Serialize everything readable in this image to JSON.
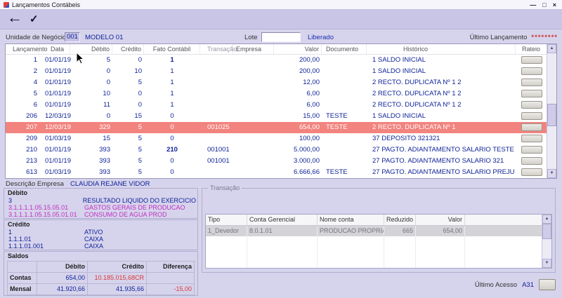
{
  "window": {
    "title": "Lançamentos Contábeis",
    "controls": {
      "minimize": "—",
      "maximize": "□",
      "close": "×"
    }
  },
  "toolbar": {
    "back_icon": "←",
    "confirm_icon": "✓"
  },
  "header_fields": {
    "unit_label": "Unidade de Negócio",
    "unit_code": "001",
    "unit_name": "MODELO 01",
    "lote_label": "Lote",
    "lote_value": "",
    "status": "Liberado",
    "last_entry_label": "Último Lançamento",
    "last_entry_value": "********"
  },
  "grid": {
    "columns": [
      "Lançamento",
      "Data",
      "Débito",
      "Crédito",
      "Fato Contábil",
      "Transação",
      "Empresa",
      "Valor",
      "Documento",
      "Histórico",
      "Rateio"
    ],
    "rows": [
      {
        "lancamento": "1",
        "data": "01/01/19",
        "debito": "5",
        "credito": "0",
        "fato_contabil": "1",
        "fato_bold": true,
        "transacao": "",
        "empresa": "",
        "valor": "200,00",
        "documento": "",
        "historico": "1 SALDO INICIAL"
      },
      {
        "lancamento": "2",
        "data": "01/01/19",
        "debito": "0",
        "credito": "10",
        "fato_contabil": "1",
        "fato_bold": false,
        "transacao": "",
        "empresa": "",
        "valor": "200,00",
        "documento": "",
        "historico": "1 SALDO INICIAL"
      },
      {
        "lancamento": "4",
        "data": "01/01/19",
        "debito": "0",
        "credito": "5",
        "fato_contabil": "1",
        "fato_bold": false,
        "transacao": "",
        "empresa": "",
        "valor": "12,00",
        "documento": "",
        "historico": "2 RECTO. DUPLICATA Nº 1 2"
      },
      {
        "lancamento": "5",
        "data": "01/01/19",
        "debito": "10",
        "credito": "0",
        "fato_contabil": "1",
        "fato_bold": false,
        "transacao": "",
        "empresa": "",
        "valor": "6,00",
        "documento": "",
        "historico": "2 RECTO. DUPLICATA Nº 1 2"
      },
      {
        "lancamento": "6",
        "data": "01/01/19",
        "debito": "11",
        "credito": "0",
        "fato_contabil": "1",
        "fato_bold": false,
        "transacao": "",
        "empresa": "",
        "valor": "6,00",
        "documento": "",
        "historico": "2 RECTO. DUPLICATA Nº 1 2"
      },
      {
        "lancamento": "206",
        "data": "12/03/19",
        "debito": "0",
        "credito": "15",
        "fato_contabil": "0",
        "fato_bold": false,
        "transacao": "",
        "empresa": "",
        "valor": "15,00",
        "documento": "TESTE",
        "historico": "1 SALDO INICIAL"
      },
      {
        "lancamento": "207",
        "data": "12/03/19",
        "debito": "329",
        "credito": "5",
        "fato_contabil": "0",
        "fato_bold": false,
        "transacao": "001025",
        "empresa": "",
        "valor": "654,00",
        "documento": "TESTE",
        "historico": "2 RECTO. DUPLICATA Nº 1",
        "selected": true
      },
      {
        "lancamento": "209",
        "data": "01/03/19",
        "debito": "15",
        "credito": "5",
        "fato_contabil": "0",
        "fato_bold": false,
        "transacao": "",
        "empresa": "",
        "valor": "100,00",
        "documento": "",
        "historico": "37 DEPOSITO 321321"
      },
      {
        "lancamento": "210",
        "data": "01/01/19",
        "debito": "393",
        "credito": "5",
        "fato_contabil": "210",
        "fato_bold": true,
        "transacao": "001001",
        "empresa": "",
        "valor": "5.000,00",
        "documento": "",
        "historico": "27 PAGTO. ADIANTAMENTO SALARIO TESTE"
      },
      {
        "lancamento": "213",
        "data": "01/01/19",
        "debito": "393",
        "credito": "5",
        "fato_contabil": "0",
        "fato_bold": false,
        "transacao": "001001",
        "empresa": "",
        "valor": "3.000,00",
        "documento": "",
        "historico": "27 PAGTO. ADIANTAMENTO SALARIO 321"
      },
      {
        "lancamento": "613",
        "data": "01/03/19",
        "debito": "393",
        "credito": "5",
        "fato_contabil": "0",
        "fato_bold": false,
        "transacao": "",
        "empresa": "",
        "valor": "6.666,66",
        "documento": "TESTE",
        "historico": "27 PAGTO. ADIANTAMENTO SALARIO PREJU"
      }
    ]
  },
  "details": {
    "empresa_label": "Descrição Empresa",
    "empresa_value": "CLAUDIA REJANE VIDOR",
    "debito_box": {
      "title": "Débito",
      "accounts": [
        {
          "code": "3",
          "name": "RESULTADO LIQUIDO DO EXERCICIO",
          "highlight": false
        },
        {
          "code": "3.1.1.1.1.05.15.05.01",
          "name": "GASTOS GERAIS DE PRODUCAO",
          "highlight": true
        },
        {
          "code": "3.1.1.1.1.05.15.05.01.01",
          "name": "CONSUMO DE AGUA PROD",
          "highlight": true
        }
      ]
    },
    "credito_box": {
      "title": "Crédito",
      "accounts": [
        {
          "code": "1",
          "name": "ATIVO",
          "highlight": false
        },
        {
          "code": "1.1.1.01",
          "name": "CAIXA",
          "highlight": false
        },
        {
          "code": "1.1.1.01.001",
          "name": "CAIXA",
          "highlight": false
        }
      ]
    },
    "saldos_box": {
      "title": "Saldos",
      "columns": [
        "Débito",
        "Crédito",
        "Diferença"
      ],
      "rows": [
        {
          "label": "Contas",
          "debito": "654,00",
          "credito": "10.185.015,68CR",
          "credito_negative": true,
          "diferenca": "",
          "diferenca_negative": false
        },
        {
          "label": "Mensal",
          "debito": "41.920,66",
          "credito": "41.935,66",
          "credito_negative": false,
          "diferenca": "-15,00",
          "diferenca_negative": true
        }
      ]
    }
  },
  "transacao": {
    "title": "Transação",
    "columns": [
      "Tipo",
      "Conta Gerencial",
      "Nome conta",
      "Reduzido",
      "Valor"
    ],
    "rows": [
      {
        "tipo": "1_Devedor",
        "conta_gerencial": "8.0.1.01",
        "nome_conta": "PRODUCAO PROPRIA",
        "reduzido": "665",
        "valor": "654,00"
      }
    ]
  },
  "footer": {
    "last_access_label": "Último Acesso",
    "last_access_value": "A31"
  },
  "colors": {
    "background": "#d6d3ec",
    "selected_row": "#f2837e",
    "navy_text": "#0b1f97",
    "magenta_text": "#bf30bf",
    "negative_red": "#d83838"
  }
}
